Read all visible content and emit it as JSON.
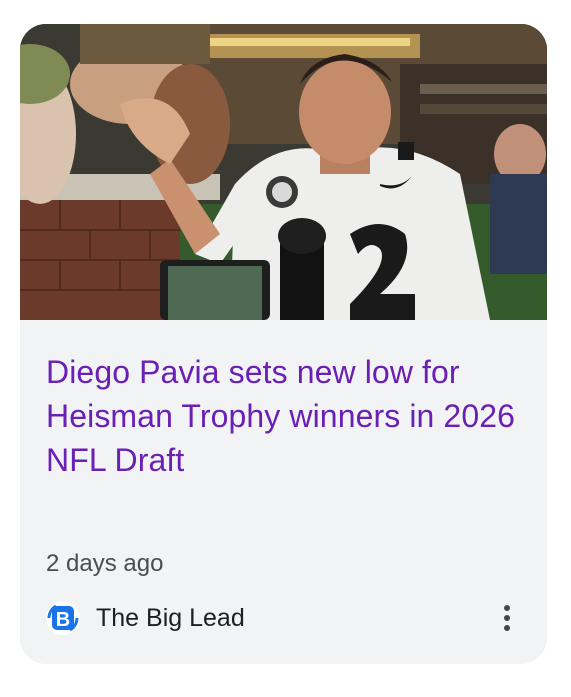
{
  "card": {
    "image_alt": "Football player in white jersey celebrating with fans",
    "headline": "Diego Pavia sets new low for Heisman Trophy winners in 2026 NFL Draft",
    "timestamp": "2 days ago",
    "source": {
      "name": "The Big Lead",
      "logo_letter": "B",
      "logo_color": "#1a73e8"
    },
    "more_icon": "more-vert-icon"
  },
  "colors": {
    "headline": "#6a1fb5",
    "card_background": "#f1f3f4",
    "meta_text": "#4a4d51"
  }
}
